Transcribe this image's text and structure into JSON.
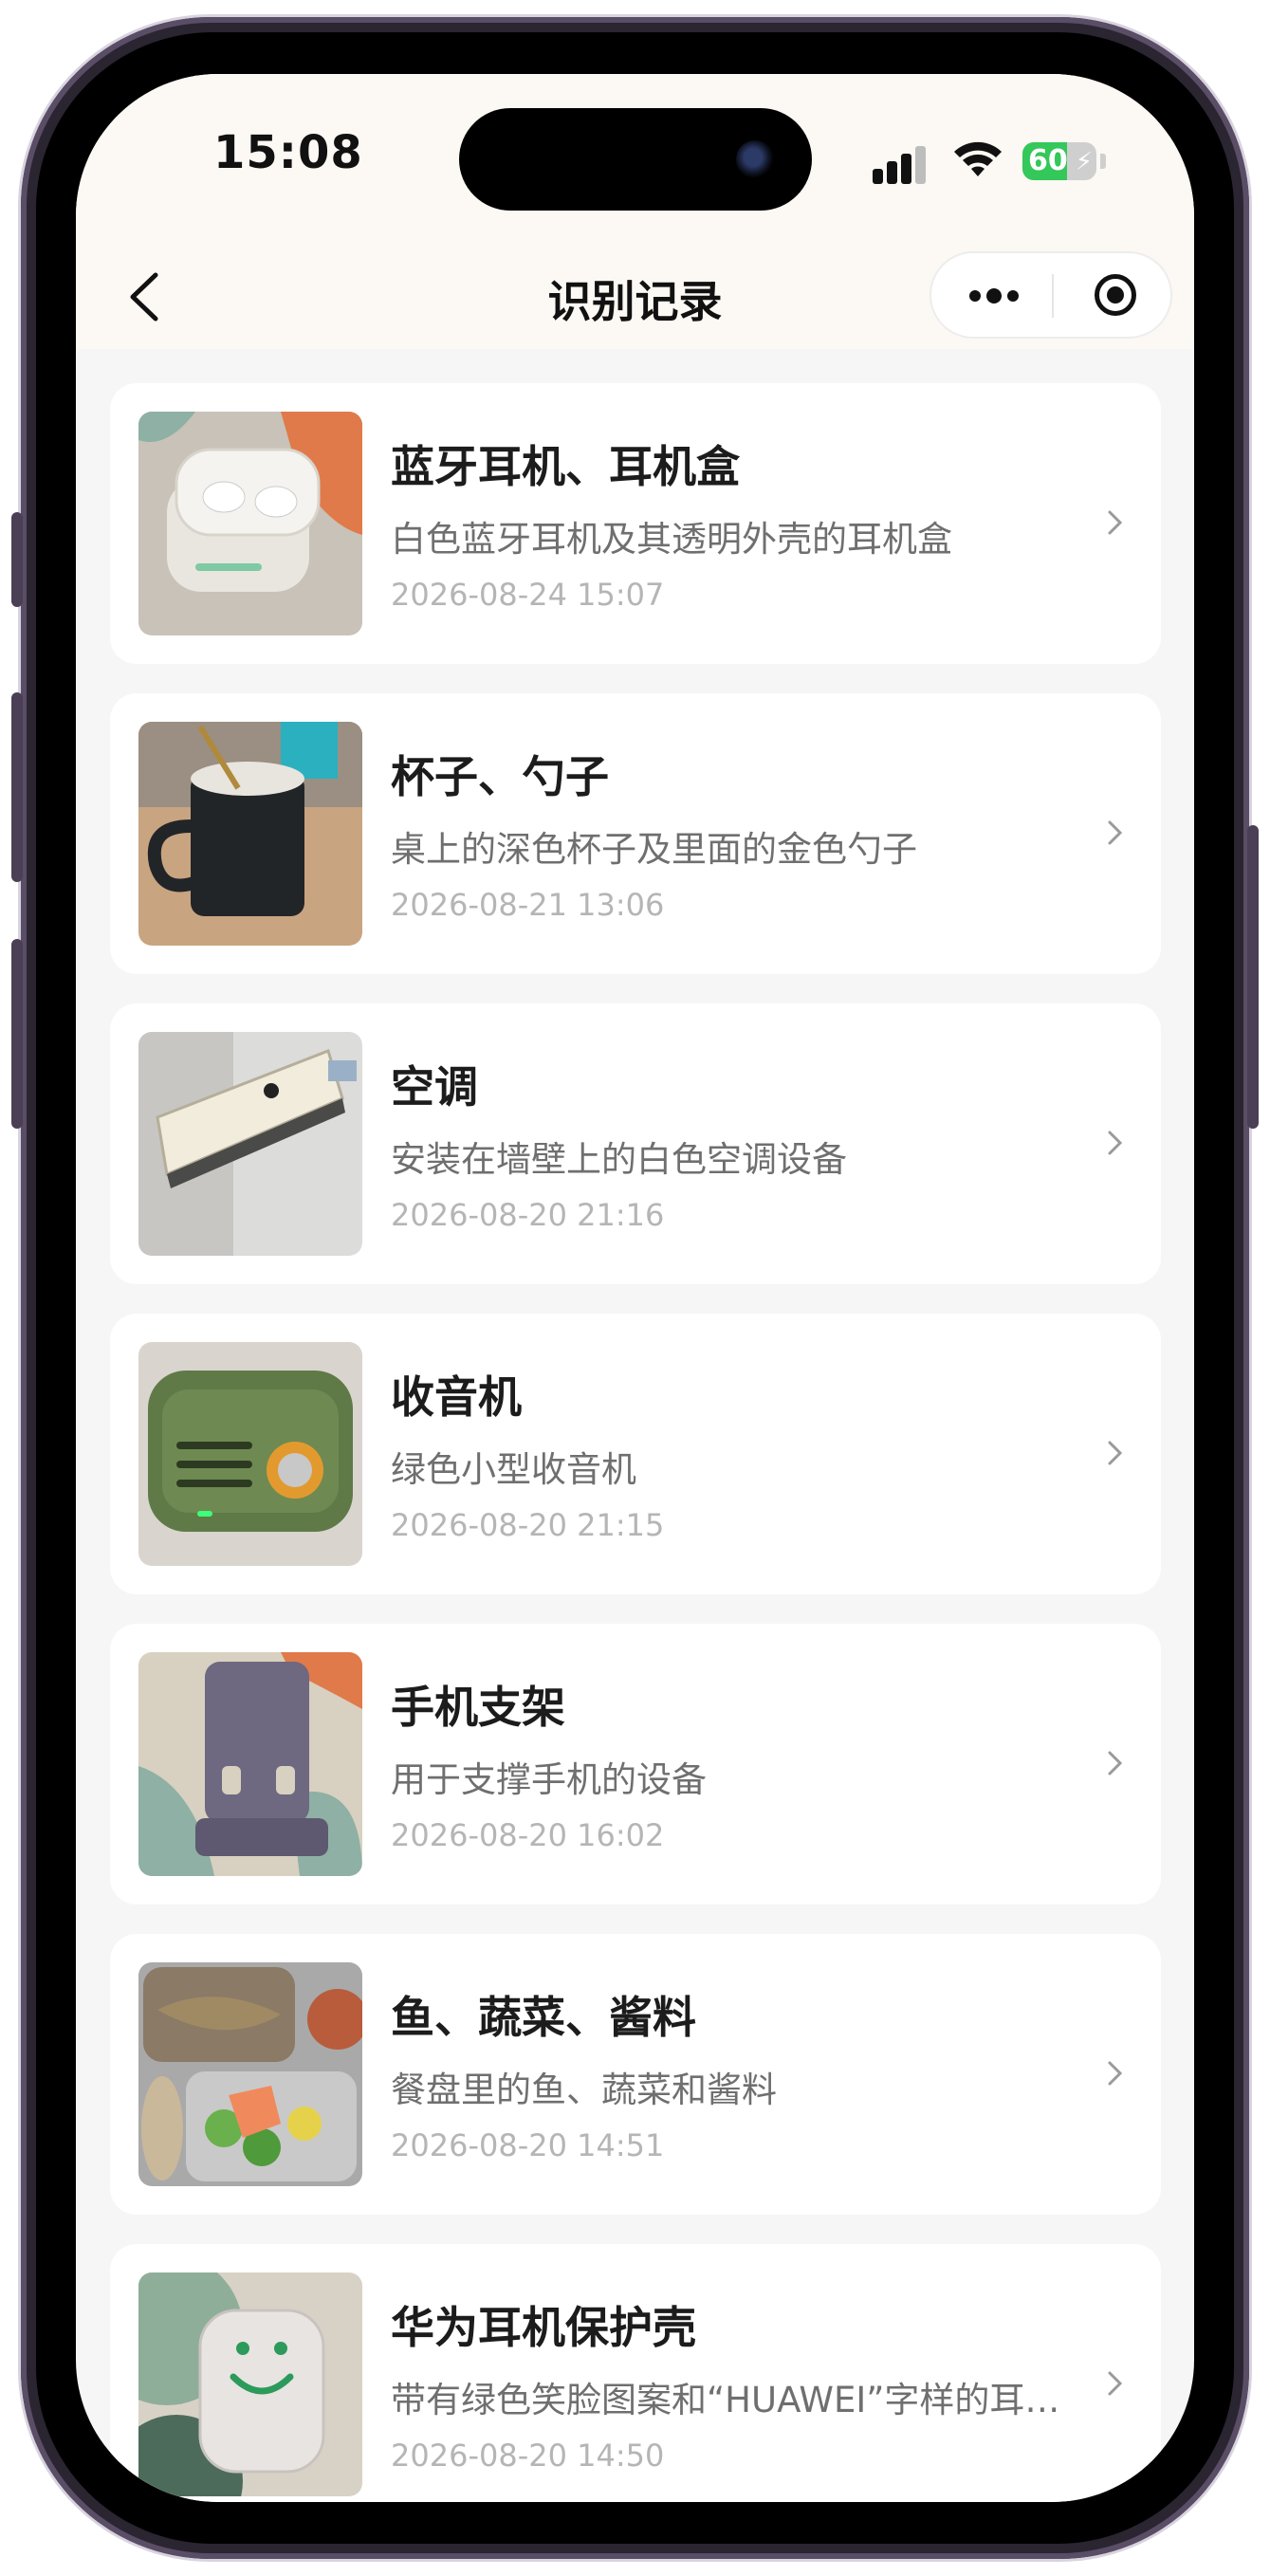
{
  "status_bar": {
    "time": "15:08",
    "battery": "60",
    "battery_level": 0.6
  },
  "nav": {
    "title": "识别记录"
  },
  "records": [
    {
      "title": "蓝牙耳机、耳机盒",
      "desc": "白色蓝牙耳机及其透明外壳的耳机盒",
      "date": "2026-08-24 15:07",
      "thumb": "earbuds-case-photo"
    },
    {
      "title": "杯子、勺子",
      "desc": "桌上的深色杯子及里面的金色勺子",
      "date": "2026-08-21 13:06",
      "thumb": "mug-spoon-photo"
    },
    {
      "title": "空调",
      "desc": "安装在墙壁上的白色空调设备",
      "date": "2026-08-20 21:16",
      "thumb": "air-conditioner-photo"
    },
    {
      "title": "收音机",
      "desc": "绿色小型收音机",
      "date": "2026-08-20 21:15",
      "thumb": "radio-photo"
    },
    {
      "title": "手机支架",
      "desc": "用于支撑手机的设备",
      "date": "2026-08-20 16:02",
      "thumb": "phone-stand-photo"
    },
    {
      "title": "鱼、蔬菜、酱料",
      "desc": "餐盘里的鱼、蔬菜和酱料",
      "date": "2026-08-20 14:51",
      "thumb": "food-tray-photo"
    },
    {
      "title": "华为耳机保护壳",
      "desc": "带有绿色笑脸图案和“HUAWEI”字样的耳机保护壳",
      "date": "2026-08-20 14:50",
      "thumb": "huawei-case-photo"
    }
  ]
}
